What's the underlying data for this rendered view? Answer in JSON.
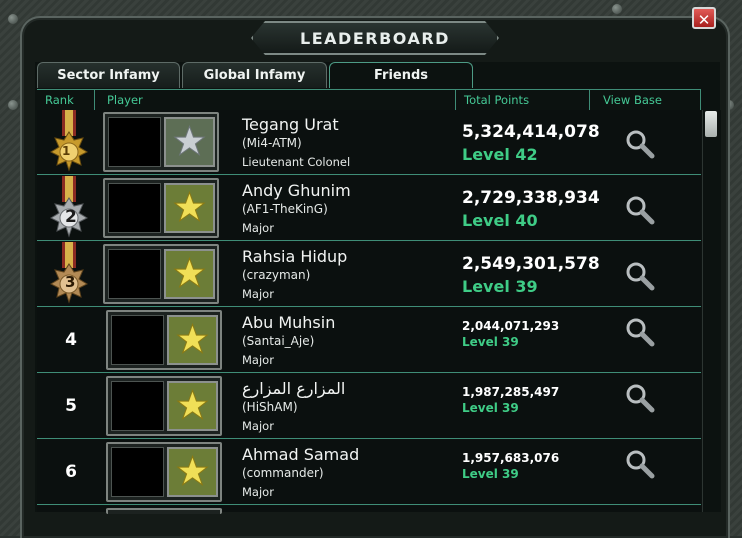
{
  "window": {
    "title": "LEADERBOARD",
    "close_label": "✕"
  },
  "tabs": [
    {
      "label": "Sector Infamy",
      "active": false
    },
    {
      "label": "Global Infamy",
      "active": false
    },
    {
      "label": "Friends",
      "active": true
    }
  ],
  "columns": {
    "rank": "Rank",
    "player": "Player",
    "total_points": "Total Points",
    "view_base": "View Base"
  },
  "rows": [
    {
      "rank": "1",
      "medal": "gold",
      "name": "Tegang Urat",
      "alias": "(Mi4-ATM)",
      "rank_title": "Lieutenant Colonel",
      "points": "5,324,414,078",
      "level": "Level 42",
      "badge": "silver-star-icon"
    },
    {
      "rank": "2",
      "medal": "silver",
      "name": "Andy Ghunim",
      "alias": "(AF1-TheKinG)",
      "rank_title": "Major",
      "points": "2,729,338,934",
      "level": "Level 40",
      "badge": "gold-star-icon"
    },
    {
      "rank": "3",
      "medal": "bronze",
      "name": "Rahsia Hidup",
      "alias": "(crazyman)",
      "rank_title": "Major",
      "points": "2,549,301,578",
      "level": "Level 39",
      "badge": "gold-star-icon"
    },
    {
      "rank": "4",
      "medal": "",
      "name": "Abu Muhsin",
      "alias": "(Santai_Aje)",
      "rank_title": "Major",
      "points": "2,044,071,293",
      "level": "Level 39",
      "badge": "gold-star-icon"
    },
    {
      "rank": "5",
      "medal": "",
      "name": "المزارع المزارع",
      "alias": "(HiShAM)",
      "rank_title": "Major",
      "points": "1,987,285,497",
      "level": "Level 39",
      "badge": "gold-star-icon"
    },
    {
      "rank": "6",
      "medal": "",
      "name": "Ahmad Samad",
      "alias": "(commander)",
      "rank_title": "Major",
      "points": "1,957,683,076",
      "level": "Level 39",
      "badge": "gold-star-icon"
    }
  ],
  "colors": {
    "accent_green": "#3fcc86",
    "header_green": "#45c996",
    "border_green": "#3f8d77",
    "close_red": "#c6312e"
  }
}
